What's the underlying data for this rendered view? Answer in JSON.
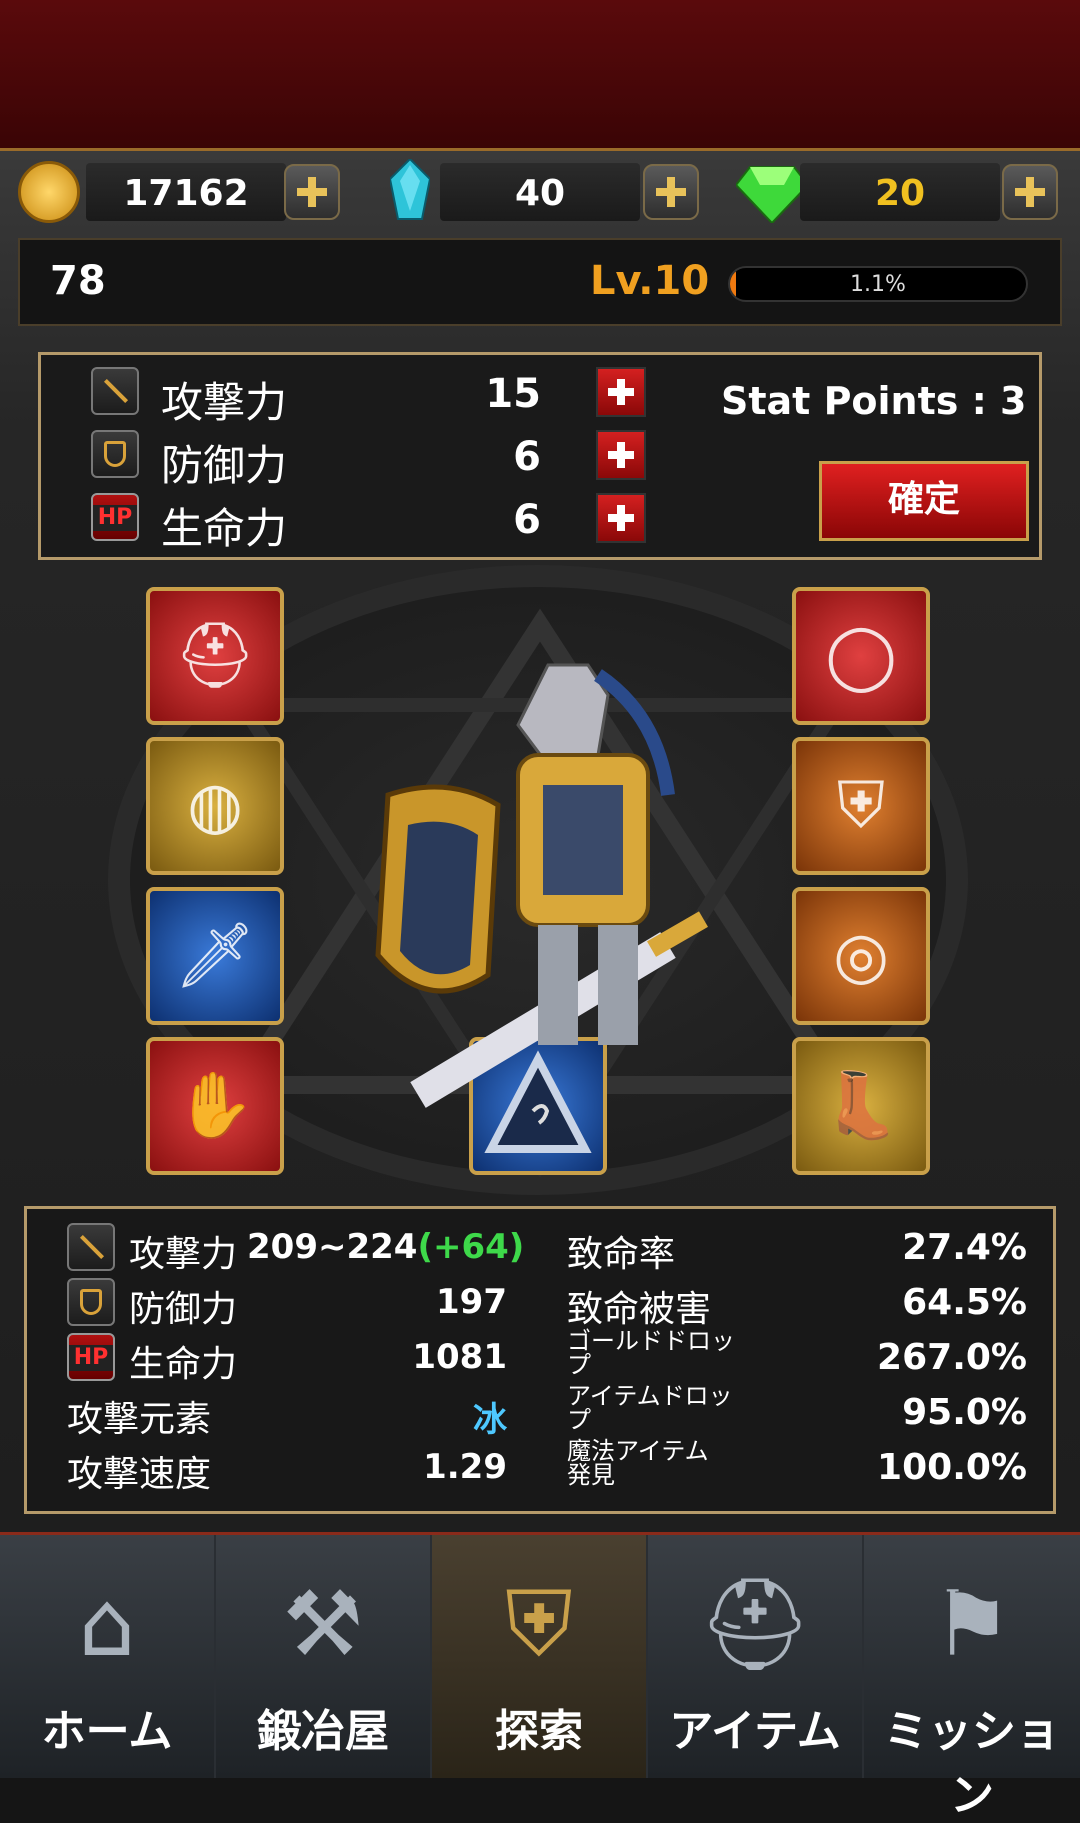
{
  "currency": {
    "gold": "17162",
    "crystal": "40",
    "gem": "20"
  },
  "level": {
    "left_value": "78",
    "label": "Lv.10",
    "xp_percent_text": "1.1%",
    "xp_fraction": 0.011
  },
  "allocation": {
    "rows": [
      {
        "label": "攻撃力",
        "value": "15",
        "icon": "sword-icon"
      },
      {
        "label": "防御力",
        "value": "6",
        "icon": "shield-icon"
      },
      {
        "label": "生命力",
        "value": "6",
        "icon": "hp-icon"
      }
    ],
    "hp_badge": "HP",
    "stat_points": "Stat Points : 3",
    "confirm_label": "確定"
  },
  "equipment": {
    "left_slots": [
      "helmet",
      "bag",
      "dagger",
      "gauntlet"
    ],
    "right_slots": [
      "necklace",
      "armor",
      "ring",
      "boots"
    ],
    "center_slot": "crest"
  },
  "stats": {
    "attack": {
      "label": "攻撃力",
      "value": "209~224",
      "bonus": "(+64)"
    },
    "defense": {
      "label": "防御力",
      "value": "197"
    },
    "hp": {
      "label": "生命力",
      "value": "1081"
    },
    "element": {
      "label": "攻撃元素",
      "value": "冰"
    },
    "speed": {
      "label": "攻撃速度",
      "value": "1.29"
    },
    "crit_rate": {
      "label": "致命率",
      "value": "27.4%"
    },
    "crit_damage": {
      "label": "致命被害",
      "value": "64.5%"
    },
    "gold_drop": {
      "label1": "ゴールドドロッ",
      "label2": "プ",
      "value": "267.0%"
    },
    "item_drop": {
      "label1": "アイテムドロッ",
      "label2": "プ",
      "value": "95.0%"
    },
    "magic_find": {
      "label1": "魔法アイテム",
      "label2": "発見",
      "value": "100.0%"
    }
  },
  "nav": [
    {
      "label": "ホーム",
      "icon": "home-icon"
    },
    {
      "label": "鍛冶屋",
      "icon": "anvil-icon"
    },
    {
      "label": "探索",
      "icon": "crest-icon"
    },
    {
      "label": "アイテム",
      "icon": "helmet-icon"
    },
    {
      "label": "ミッション",
      "icon": "banner-icon"
    }
  ],
  "colors": {
    "accent_gold": "#c9a04a",
    "level_orange": "#f0a020",
    "bonus_green": "#3ed94a",
    "ice_blue": "#4ec8ff",
    "button_red": "#d42020"
  }
}
